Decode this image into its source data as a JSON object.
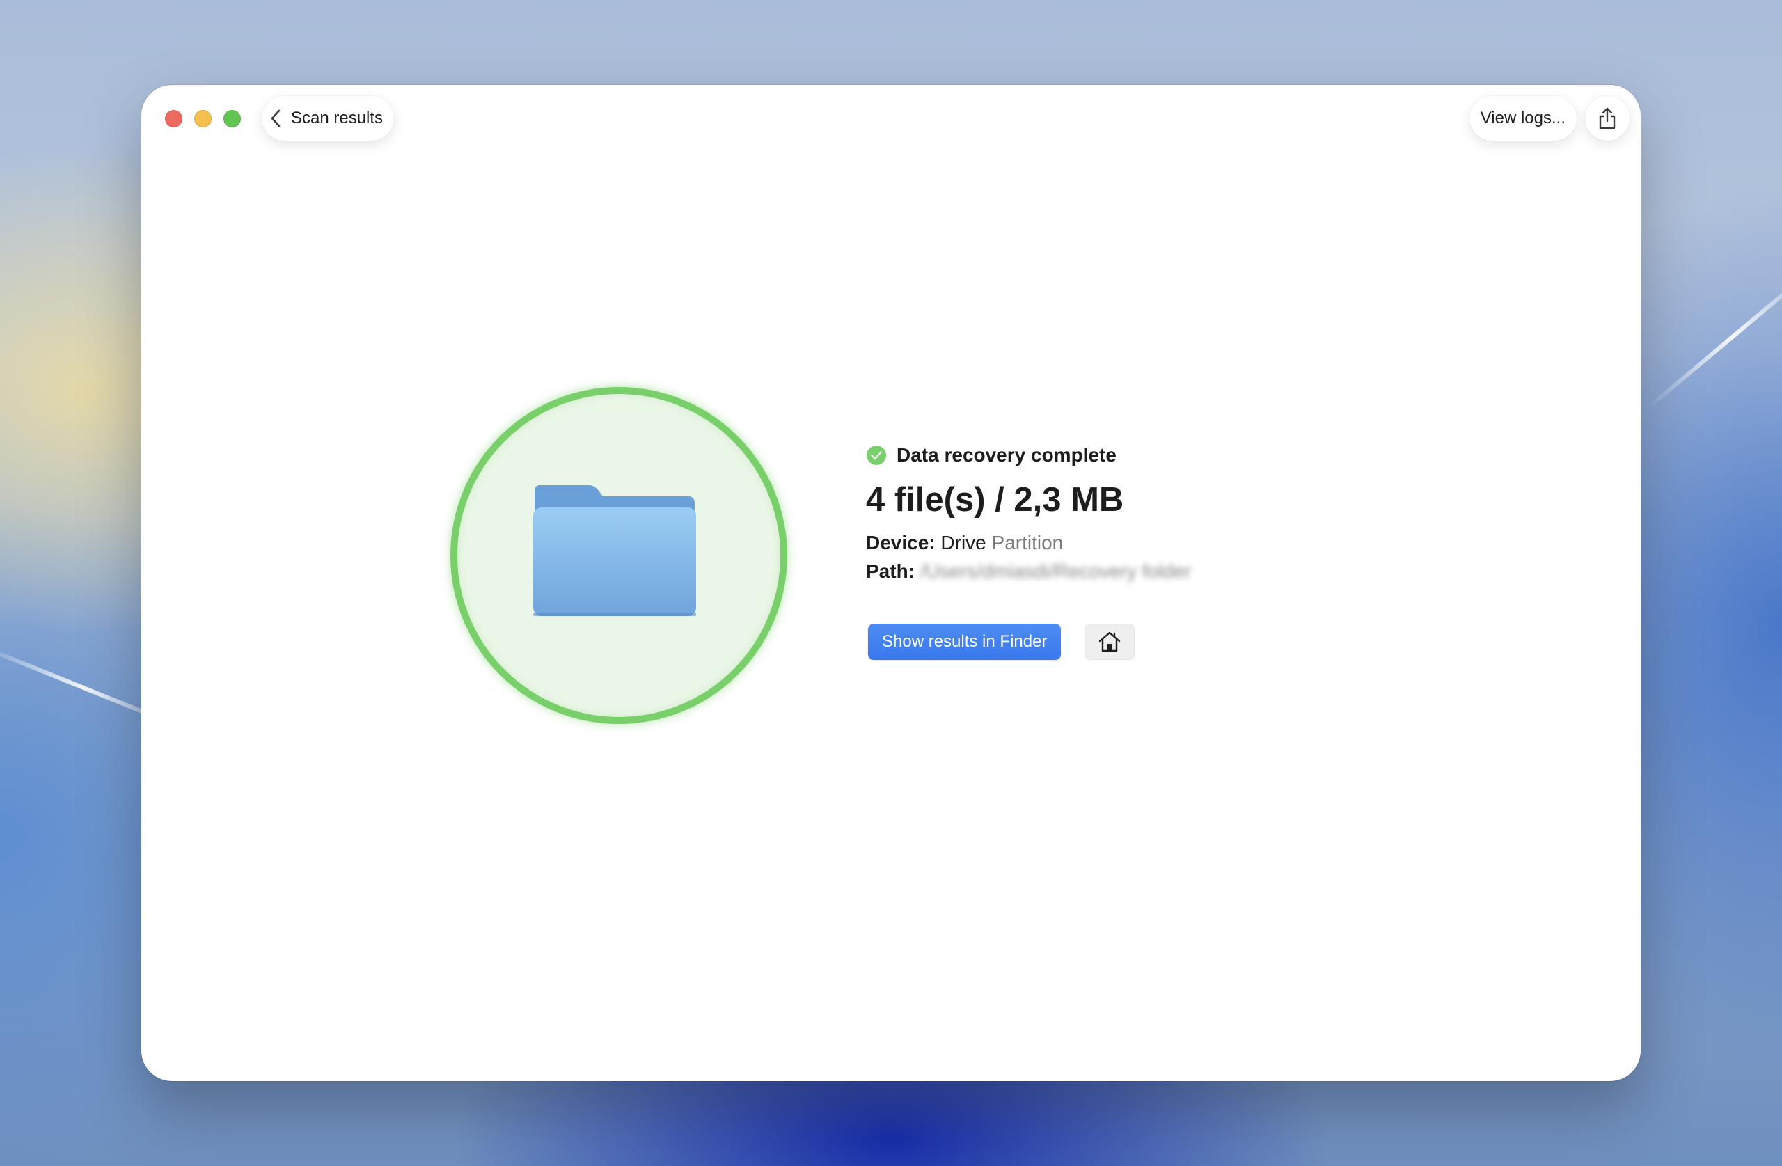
{
  "window": {
    "back_label": "Scan results",
    "view_logs_label": "View logs..."
  },
  "traffic_lights": {
    "close_color": "#ec6a5e",
    "minimize_color": "#f4bf4f",
    "zoom_color": "#61c554"
  },
  "result": {
    "status": "Data recovery complete",
    "summary": "4 file(s) / 2,3 MB",
    "device_label": "Device:",
    "device_name": "Drive",
    "device_type": "Partition",
    "path_label": "Path:",
    "path_value": "/Users/dmiasdi/Recovery folder"
  },
  "actions": {
    "show_in_finder_label": "Show results in Finder"
  },
  "colors": {
    "accent": "#3b82f6",
    "success": "#79cf69",
    "folder": "#7fb3e6"
  },
  "icons": {
    "back": "chevron-left-icon",
    "share": "share-icon",
    "status": "checkmark-circle-icon",
    "hero": "folder-icon",
    "home": "home-icon"
  }
}
